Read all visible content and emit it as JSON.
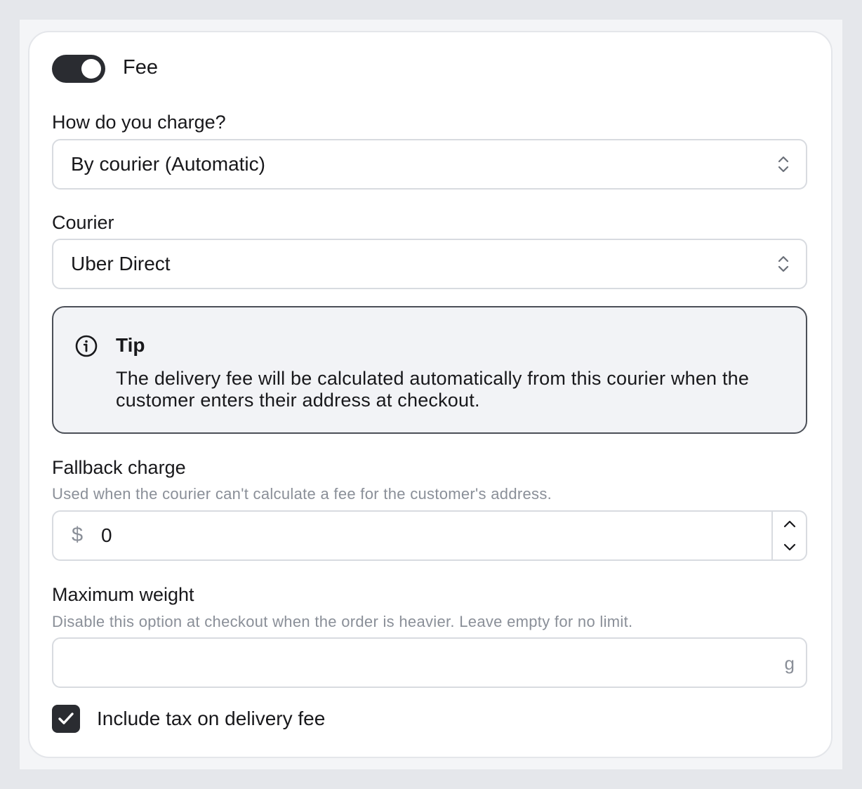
{
  "fee": {
    "label": "Fee",
    "enabled": true
  },
  "charge_method": {
    "label": "How do you charge?",
    "value": "By courier (Automatic)"
  },
  "courier": {
    "label": "Courier",
    "value": "Uber Direct"
  },
  "tip": {
    "title": "Tip",
    "body": "The delivery fee will be calculated automatically from this courier when the customer enters their address at checkout."
  },
  "fallback": {
    "label": "Fallback charge",
    "help": "Used when the courier can't calculate a fee for the customer's address.",
    "prefix": "$",
    "value": "0"
  },
  "max_weight": {
    "label": "Maximum weight",
    "help": "Disable this option at checkout when the order is heavier. Leave empty for no limit.",
    "value": "",
    "suffix": "g"
  },
  "include_tax": {
    "label": "Include tax on delivery fee",
    "checked": true
  },
  "colors": {
    "accent": "#2a2c31",
    "border": "#d8dbe0",
    "muted": "#8a8f98",
    "tip_bg": "#f2f3f6"
  }
}
